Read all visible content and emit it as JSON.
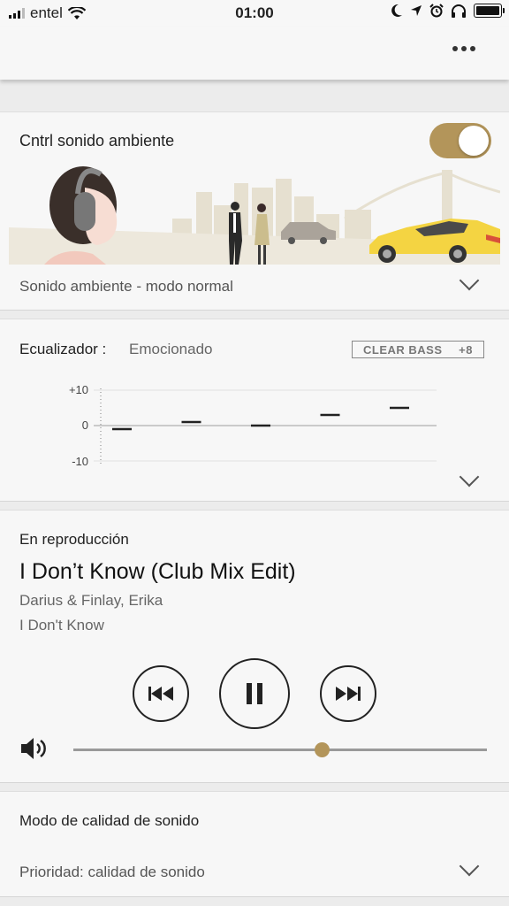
{
  "status_bar": {
    "carrier": "entel",
    "time": "01:00",
    "icons": [
      "signal-icon",
      "wifi-icon",
      "moon-icon",
      "location-icon",
      "alarm-icon",
      "headphones-icon",
      "battery-icon"
    ]
  },
  "top_bar": {
    "menu_icon": "more-icon"
  },
  "ambient": {
    "title": "Cntrl sonido ambiente",
    "toggle_on": true,
    "mode_label": "Sonido ambiente - modo normal"
  },
  "equalizer": {
    "label": "Ecualizador :",
    "preset": "Emocionado",
    "clear_bass_label": "CLEAR BASS",
    "clear_bass_value": "+8",
    "tick_labels": [
      "+10",
      "0",
      "-10"
    ],
    "band_levels": [
      -1,
      1,
      0,
      3,
      5
    ]
  },
  "now_playing": {
    "section_title": "En reproducción",
    "track": "I Don’t Know (Club Mix Edit)",
    "artist": "Darius & Finlay, Erika",
    "album": "I Don't Know",
    "volume_fraction": 0.6
  },
  "sound_quality": {
    "title": "Modo de calidad de sonido",
    "value": "Prioridad: calidad de sonido"
  },
  "colors": {
    "accent": "#b3955a"
  }
}
